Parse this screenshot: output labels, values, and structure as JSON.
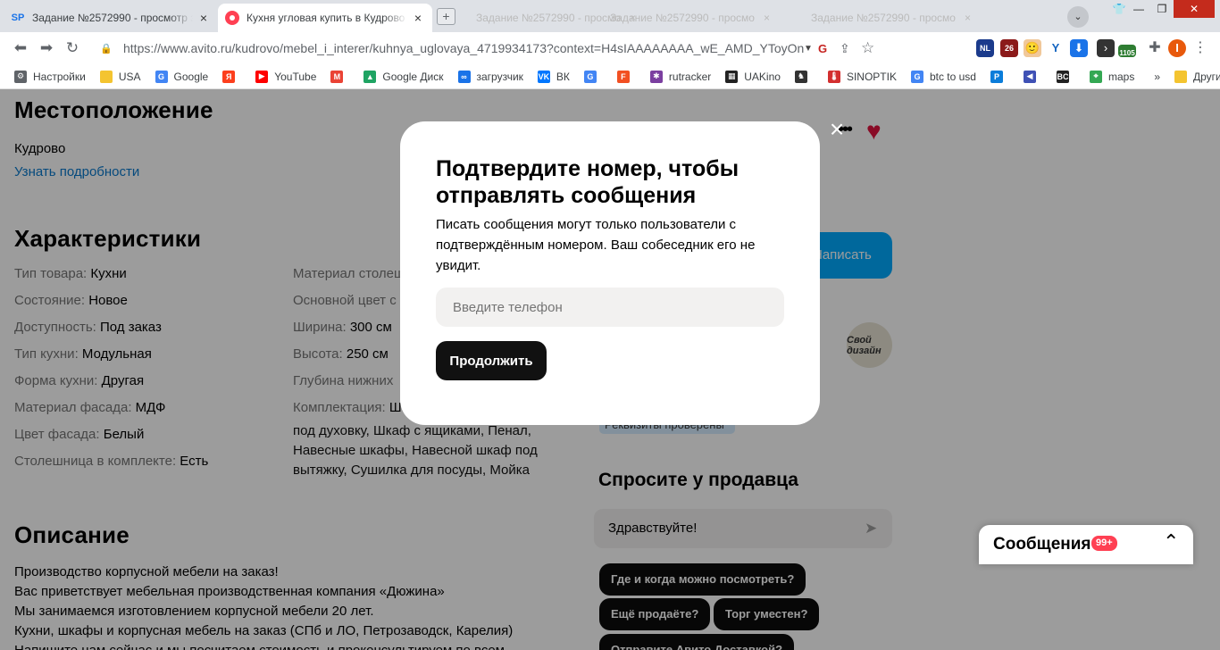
{
  "tabs": [
    {
      "label": "Задание №2572990 - просмотр з",
      "favicon": "SP",
      "close": "×"
    },
    {
      "label": "Кухня угловая купить в Кудрово г",
      "favicon": "",
      "close": "×"
    }
  ],
  "ghost_tabs": [
    {
      "label": "Задание №2572990 - просмо"
    },
    {
      "label": "Задание №2572990 - просмо"
    },
    {
      "label": "Задание №2572990 - просмо"
    }
  ],
  "newtab": "+",
  "window_controls": {
    "min": "—",
    "max": "❐",
    "close": "✕"
  },
  "nav": {
    "back": "⬅",
    "forward": "➡",
    "reload": "↻"
  },
  "address": {
    "host": "https://www.avito.ru",
    "path": "/kudrovo/mebel_i_interer/kuhnya_uglovaya_4719934173?context=H4sIAAAAAAAA_wE_AMD_YToyOntzOjEzOiJsb..."
  },
  "toolbar_icons": {
    "translate": "G",
    "share": "⇪",
    "star": "☆",
    "ext_nl": "NL",
    "ext_cal": "26",
    "ext_count": "1105",
    "profile": "I",
    "menu": "⋮"
  },
  "bookmarks": [
    {
      "label": "Настройки",
      "icon": "⚙",
      "color": "#5f6368"
    },
    {
      "label": "USA",
      "icon": "",
      "color": "#f4c430"
    },
    {
      "label": "Google",
      "icon": "G",
      "color": "#4285f4"
    },
    {
      "label": "",
      "icon": "Я",
      "color": "#fc3f1d"
    },
    {
      "label": "YouTube",
      "icon": "▶",
      "color": "#ff0000"
    },
    {
      "label": "",
      "icon": "M",
      "color": "#ea4335"
    },
    {
      "label": "Google Диск",
      "icon": "▲",
      "color": "#1fa463"
    },
    {
      "label": "загрузчик",
      "icon": "∞",
      "color": "#1a73e8"
    },
    {
      "label": "ВК",
      "icon": "VK",
      "color": "#0077ff"
    },
    {
      "label": "",
      "icon": "G",
      "color": "#4285f4"
    },
    {
      "label": "",
      "icon": "F",
      "color": "#f25022"
    },
    {
      "label": "rutracker",
      "icon": "✱",
      "color": "#7b3fa0"
    },
    {
      "label": "UAKino",
      "icon": "▦",
      "color": "#222222"
    },
    {
      "label": "",
      "icon": "♞",
      "color": "#333333"
    },
    {
      "label": "SINOPTIK",
      "icon": "🌡",
      "color": "#d32f2f"
    },
    {
      "label": "btc to usd",
      "icon": "G",
      "color": "#4285f4"
    },
    {
      "label": "",
      "icon": "P",
      "color": "#0b7dda"
    },
    {
      "label": "",
      "icon": "◀",
      "color": "#3f51b5"
    },
    {
      "label": "",
      "icon": "BC",
      "color": "#222222"
    },
    {
      "label": "maps",
      "icon": "⌖",
      "color": "#34a853"
    }
  ],
  "bookmarks_more": "»",
  "bookmarks_other": "Другие закладки",
  "location": {
    "title": "Местоположение",
    "place": "Кудрово",
    "details_link": "Узнать подробности"
  },
  "characteristics": {
    "title": "Характеристики",
    "left": [
      {
        "key": "Тип товара: ",
        "value": "Кухни"
      },
      {
        "key": "Состояние: ",
        "value": "Новое"
      },
      {
        "key": "Доступность: ",
        "value": "Под заказ"
      },
      {
        "key": "Тип кухни: ",
        "value": "Модульная"
      },
      {
        "key": "Форма кухни: ",
        "value": "Другая"
      },
      {
        "key": "Материал фасада: ",
        "value": "МДФ"
      },
      {
        "key": "Цвет фасада: ",
        "value": "Белый"
      },
      {
        "key": "Столешница в комплекте: ",
        "value": "Есть"
      }
    ],
    "right": [
      {
        "key": "Материал столешницы: ",
        "value": ""
      },
      {
        "key": "Основной цвет с",
        "value": ""
      },
      {
        "key": "Ширина: ",
        "value": "300 см"
      },
      {
        "key": "Высота: ",
        "value": "250 см"
      },
      {
        "key": "Глубина нижних",
        "value": ""
      },
      {
        "key": "Комплектация: ",
        "value": "Ш"
      }
    ],
    "completeness_lines": [
      "под духовку, Шкаф с ящиками, Пенал,",
      "Навесные шкафы, Навесной шкаф под",
      "вытяжку, Сушилка для посуды, Мойка"
    ]
  },
  "description": {
    "title": "Описание",
    "lines": [
      "Производство корпусной мебели на заказ!",
      "Вас приветствует мебельная производственная компания «Дюжина»",
      "Мы занимаемся изготовлением корпусной мебели 20 лет.",
      "Кухни, шкафы и корпусная мебель на заказ (СПб и ЛО, Петрозаводск, Карелия)",
      "Напишите нам сейчас и мы посчитаем стоимость и проконсультируем по всем"
    ]
  },
  "seller": {
    "write_button": "Написать",
    "avatar_text": "Свой дизайн",
    "verified_badge": "Реквизиты проверены"
  },
  "ask_seller": {
    "title": "Спросите у продавца",
    "message": "Здравствуйте!",
    "send_icon": "➤",
    "chips": [
      "Где и когда можно посмотреть?",
      "Ещё продаёте?",
      "Торг уместен?",
      "Отправите Авито Доставкой?"
    ]
  },
  "header_actions": {
    "more": "•••",
    "favorite": "♥"
  },
  "messages_bar": {
    "label": "Сообщения",
    "count": "99+",
    "chevron": "⌃"
  },
  "modal": {
    "title": "Подтвердите номер, чтобы отправлять сообщения",
    "body": "Писать сообщения могут только пользователи с подтверждённым номером. Ваш собеседник его не увидит.",
    "phone_placeholder": "Введите телефон",
    "phone_value": "",
    "continue_label": "Продолжить",
    "close": "×"
  },
  "colors": {
    "accent_blue": "#00aaff",
    "link": "#0a7acc",
    "favorite": "#e0123e",
    "badge": "#ff4053",
    "overlay": "rgba(0,0,0,0.39)"
  }
}
